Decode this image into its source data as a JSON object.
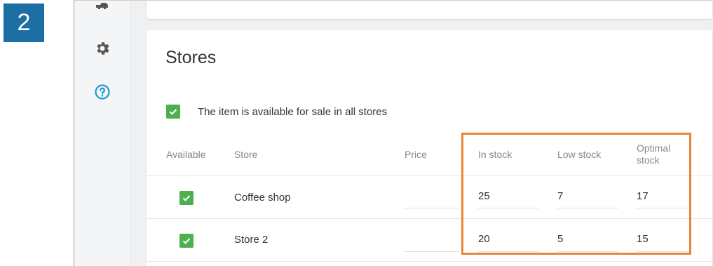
{
  "step": {
    "number": "2",
    "color": "#1c6ea4"
  },
  "sidebar": {
    "icons": [
      {
        "name": "tools-icon"
      },
      {
        "name": "gear-icon"
      },
      {
        "name": "help-icon",
        "color": "#1a9ad6"
      }
    ]
  },
  "stores_card": {
    "title": "Stores",
    "available_all": {
      "checked": true,
      "label": "The item is available for sale in all stores"
    },
    "columns": {
      "available": "Available",
      "store": "Store",
      "price": "Price",
      "in_stock": "In stock",
      "low_stock": "Low stock",
      "optimal_stock": "Optimal\nstock"
    },
    "rows": [
      {
        "available": true,
        "store": "Coffee shop",
        "price": "",
        "in_stock": "25",
        "low_stock": "7",
        "optimal_stock": "17"
      },
      {
        "available": true,
        "store": "Store 2",
        "price": "",
        "in_stock": "20",
        "low_stock": "5",
        "optimal_stock": "15"
      }
    ]
  },
  "colors": {
    "checkbox": "#4caf50",
    "highlight": "#e8863a",
    "accent": "#1a9ad6"
  }
}
